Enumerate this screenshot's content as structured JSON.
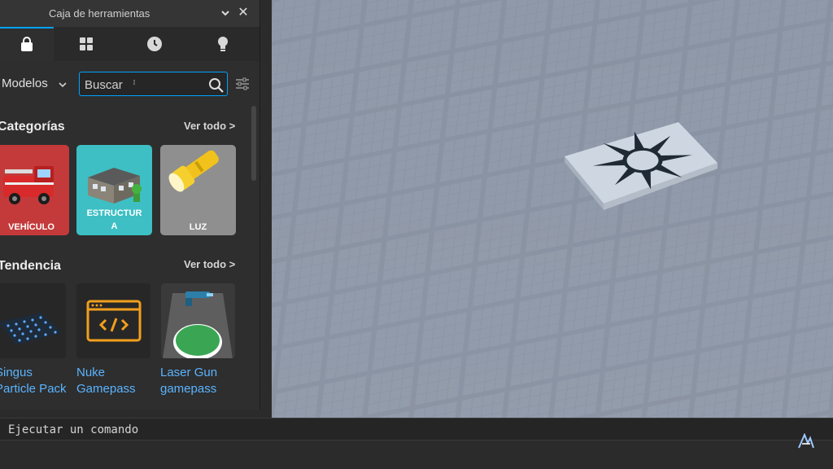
{
  "toolbox": {
    "title": "Caja de herramientas",
    "tabs": [
      {
        "name": "tab-models",
        "icon": "shopping-bag-icon",
        "active": true
      },
      {
        "name": "tab-inventory",
        "icon": "grid-icon",
        "active": false
      },
      {
        "name": "tab-recent",
        "icon": "clock-icon",
        "active": false
      },
      {
        "name": "tab-ideas",
        "icon": "lightbulb-icon",
        "active": false
      }
    ],
    "category": "Modelos",
    "search": {
      "placeholder": "Buscar",
      "value": ""
    },
    "categories": {
      "title": "Categorías",
      "see_all": "Ver todo >",
      "items": [
        {
          "label": "VEHÍCULO",
          "color": "#c43a3a",
          "icon": "fire-truck-icon"
        },
        {
          "label": "ESTRUCTUR\nA",
          "color": "#3dbfc4",
          "icon": "building-icon"
        },
        {
          "label": "LUZ",
          "color": "#8f8f8f",
          "icon": "flashlight-icon"
        }
      ]
    },
    "trending": {
      "title": "Tendencia",
      "see_all": "Ver todo >",
      "items": [
        {
          "name_line1": "Singus",
          "name_line2": "Particle Pack",
          "icon": "particle-grid-icon"
        },
        {
          "name_line1": "Nuke",
          "name_line2": "Gamepass",
          "icon": "code-window-icon"
        },
        {
          "name_line1": "Laser Gun",
          "name_line2": "gamepass",
          "icon": "laser-gun-icon"
        }
      ]
    }
  },
  "command_bar": {
    "placeholder": "Ejecutar un comando"
  },
  "colors": {
    "accent": "#00a2ff",
    "link": "#5ab4ff",
    "panel": "#2e2e2e",
    "viewport": "#8a93a3"
  }
}
